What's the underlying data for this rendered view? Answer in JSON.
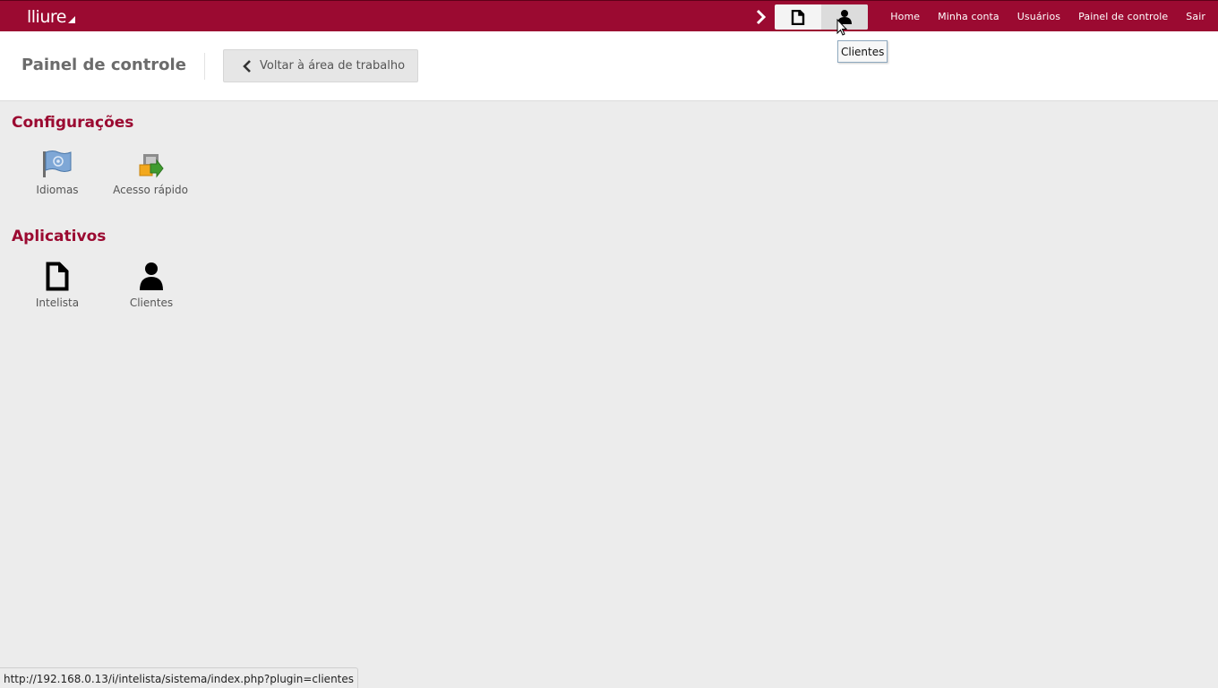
{
  "topbar": {
    "logo": "lliure",
    "quick_launch": [
      {
        "icon": "document-icon",
        "tooltip": ""
      },
      {
        "icon": "user-icon",
        "tooltip": "Clientes"
      }
    ],
    "nav": [
      "Home",
      "Minha conta",
      "Usuários",
      "Painel de controle",
      "Sair"
    ]
  },
  "header": {
    "title": "Painel de controle",
    "back_label": "Voltar à área de trabalho"
  },
  "tooltip": "Clientes",
  "sections": {
    "config": {
      "title": "Configurações",
      "items": [
        {
          "label": "Idiomas",
          "icon": "flag-icon"
        },
        {
          "label": "Acesso rápido",
          "icon": "shortcut-icon"
        }
      ]
    },
    "apps": {
      "title": "Aplicativos",
      "items": [
        {
          "label": "Intelista",
          "icon": "document-icon"
        },
        {
          "label": "Clientes",
          "icon": "user-icon"
        }
      ]
    }
  },
  "statusbar": "http://192.168.0.13/i/intelista/sistema/index.php?plugin=clientes",
  "colors": {
    "brand": "#9b0a31",
    "background": "#ececec"
  }
}
